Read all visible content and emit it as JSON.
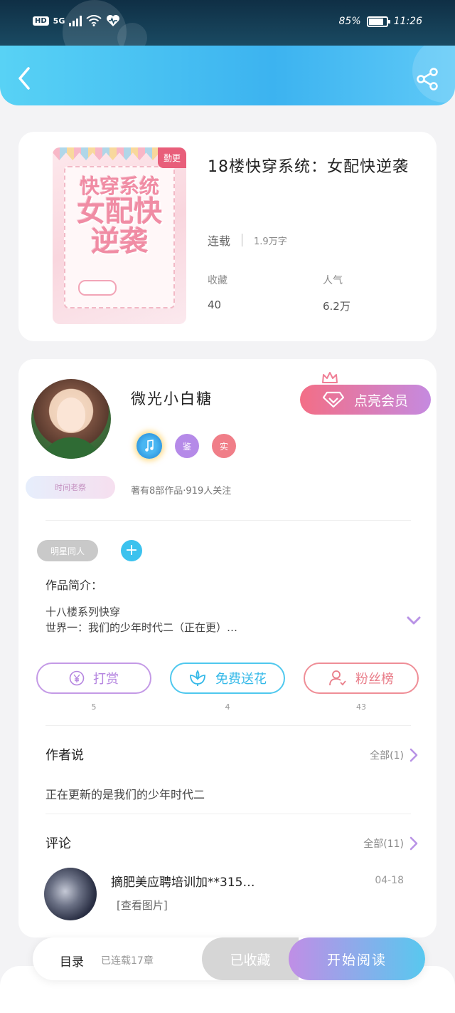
{
  "status_bar": {
    "left_badge": "HD",
    "network": "5G",
    "battery": "85%",
    "battery_level": 0.85,
    "time": "11:26"
  },
  "header": {
    "back_icon": "chevron-left-icon",
    "share_icon": "share-icon"
  },
  "book": {
    "cover_tag": "勤更",
    "cover_title_lines": [
      "快穿系统",
      "女配快",
      "逆袭"
    ],
    "title": "18楼快穿系统：女配快逆袭",
    "status": "连载",
    "word_count": "1.9万字",
    "favorites_label": "收藏",
    "favorites_value": "40",
    "popularity_label": "人气",
    "popularity_value": "6.2万"
  },
  "author": {
    "name": "微光小白糖",
    "vip_button": "点亮会员",
    "badge_jian": "鉴",
    "badge_shi": "实",
    "ribbon_text": "时间老祭",
    "stats": "著有8部作品·919人关注"
  },
  "tags": {
    "pill": "明星同人",
    "add": "+"
  },
  "intro": {
    "label": "作品简介：",
    "line1": "十八楼系列快穿",
    "line2": "世界一：我们的少年时代二（正在更）…"
  },
  "actions": {
    "reward_label": "打赏",
    "reward_count": "5",
    "flower_label": "免费送花",
    "flower_count": "4",
    "fans_label": "粉丝榜",
    "fans_count": "43"
  },
  "author_say": {
    "title": "作者说",
    "all": "全部(1)",
    "content": "正在更新的是我们的少年时代二"
  },
  "comments": {
    "title": "评论",
    "all": "全部(11)",
    "items": [
      {
        "text": "摘肥美应聘培训加**315…",
        "date": "04-18",
        "image_link": "[查看图片]"
      }
    ]
  },
  "bottom_bar": {
    "toc_label": "目录",
    "toc_count": "已连载17章",
    "fav_button": "已收藏",
    "read_button": "开始阅读"
  },
  "colors": {
    "header_start": "#58d2f5",
    "header_end": "#3cb3f0",
    "vip_start": "#f36e86",
    "vip_end": "#c58ae0",
    "reward": "#c49ae6",
    "flower": "#4fc8ee",
    "fans": "#ef8e97"
  }
}
